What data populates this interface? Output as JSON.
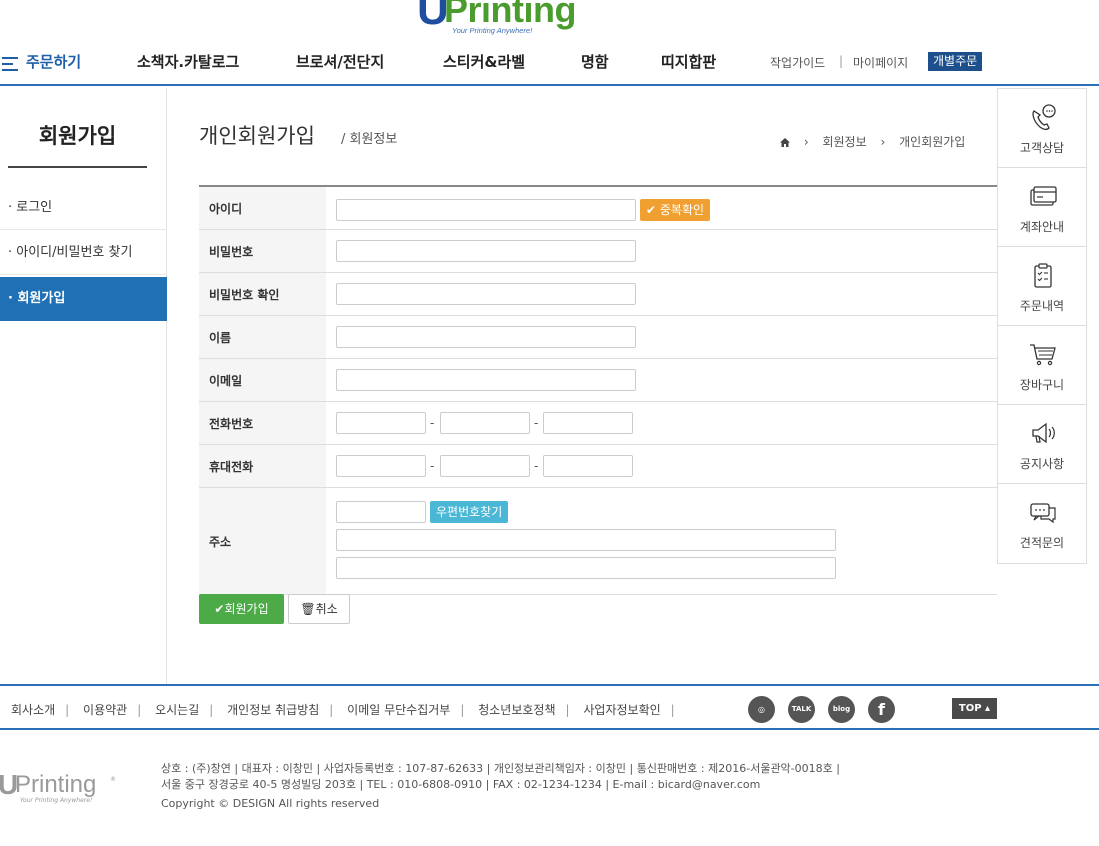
{
  "logo": {
    "u": "U",
    "printing": "Printing",
    "reg": "®",
    "tagline": "Your Printing Anywhere!"
  },
  "nav": {
    "order": "주문하기",
    "items": [
      "소책자.카탈로그",
      "브로셔/전단지",
      "스티커&라벨",
      "명함",
      "띠지합판"
    ],
    "guide": "작업가이드",
    "sep": "|",
    "mypage": "마이페이지",
    "custom": "개별주문"
  },
  "sidebar": {
    "title": "회원가입",
    "items": [
      "· 로그인",
      "· 아이디/비밀번호 찾기",
      "· 회원가입"
    ]
  },
  "page": {
    "title": "개인회원가입",
    "sub": "/ 회원정보",
    "breadcrumb": [
      "›",
      "회원정보",
      "›",
      "개인회원가입"
    ]
  },
  "form": {
    "id_label": "아이디",
    "dup_check": "✔ 중복확인",
    "pw_label": "비밀번호",
    "pw2_label": "비밀번호 확인",
    "name_label": "이름",
    "email_label": "이메일",
    "phone_label": "전화번호",
    "mobile_label": "휴대전화",
    "dash": "-",
    "addr_label": "주소",
    "zip_btn": "우편번호찾기",
    "join_btn": "✔회원가입",
    "cancel_btn": "🗑취소"
  },
  "quick": [
    "고객상담",
    "계좌안내",
    "주문내역",
    "장바구니",
    "공지사항",
    "견적문의"
  ],
  "footer": {
    "links": [
      "회사소개",
      "이용약관",
      "오시는길",
      "개인정보 취급방침",
      "이메일 무단수집거부",
      "청소년보호정책",
      "사업자정보확인"
    ],
    "social": [
      "instagram-icon",
      "talk-icon",
      "blog-icon",
      "facebook-icon"
    ],
    "social_text": [
      "◎",
      "TALK",
      "blog",
      "f"
    ],
    "top": "TOP ▴",
    "info1": "상호 : (주)창연 | 대표자 : 이창민 | 사업자등록번호 : 107-87-62633 | 개인정보관리책임자 : 이창민 | 통신판매번호 : 제2016-서울관악-0018호 |",
    "info2": "서울 중구 장경궁로 40-5 명성빌딩 203호 | TEL : 010-6808-0910 | FAX : 02-1234-1234 | E-mail : bicard@naver.com",
    "copyright": "Copyright © DESIGN All rights reserved"
  },
  "colors": {
    "primary": "#1f70b5",
    "nav_btn": "#1d4f8c",
    "check": "#f0a030",
    "zip": "#4ab7d6",
    "join": "#4caa47"
  }
}
